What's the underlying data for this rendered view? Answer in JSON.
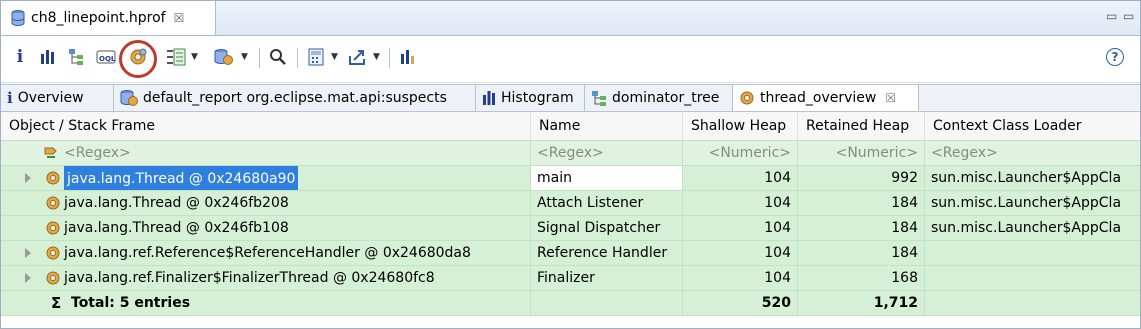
{
  "editor": {
    "tab_title": "ch8_linepoint.hprof",
    "close_glyph": "☒"
  },
  "window_controls": {
    "minimize": "▭",
    "maximize": "▭"
  },
  "toolbar": {
    "icons": [
      "info-icon",
      "histogram-icon",
      "dominator-tree-icon",
      "oql-icon",
      "thread-overview-icon",
      "query-browser-icon",
      "reports-icon",
      "search-icon",
      "calculator-icon",
      "export-icon",
      "heap-dump-overview-icon"
    ],
    "help_label": "?"
  },
  "inner_tabs": [
    {
      "label": "Overview",
      "icon": "info-icon"
    },
    {
      "label": "default_report  org.eclipse.mat.api:suspects",
      "icon": "report-gear-icon"
    },
    {
      "label": "Histogram",
      "icon": "histogram-icon"
    },
    {
      "label": "dominator_tree",
      "icon": "dominator-tree-icon"
    },
    {
      "label": "thread_overview",
      "icon": "thread-gear-icon",
      "active": true,
      "close": "☒"
    }
  ],
  "table": {
    "columns": [
      "Object / Stack Frame",
      "Name",
      "Shallow Heap",
      "Retained Heap",
      "Context Class Loader"
    ],
    "regex_row": {
      "object": "<Regex>",
      "name": "<Regex>",
      "shallow": "<Numeric>",
      "retained": "<Numeric>",
      "loader": "<Regex>"
    },
    "rows": [
      {
        "object": "java.lang.Thread @ 0x24680a90",
        "name": "main",
        "shallow": "104",
        "retained": "992",
        "loader": "sun.misc.Launcher$AppCla",
        "expandable": true,
        "selected": true
      },
      {
        "object": "java.lang.Thread @ 0x246fb208",
        "name": "Attach Listener",
        "shallow": "104",
        "retained": "184",
        "loader": "sun.misc.Launcher$AppCla",
        "expandable": false
      },
      {
        "object": "java.lang.Thread @ 0x246fb108",
        "name": "Signal Dispatcher",
        "shallow": "104",
        "retained": "184",
        "loader": "sun.misc.Launcher$AppCla",
        "expandable": false
      },
      {
        "object": "java.lang.ref.Reference$ReferenceHandler @ 0x24680da8",
        "name": "Reference Handler",
        "shallow": "104",
        "retained": "184",
        "loader": "",
        "expandable": true
      },
      {
        "object": "java.lang.ref.Finalizer$FinalizerThread @ 0x24680fc8",
        "name": "Finalizer",
        "shallow": "104",
        "retained": "168",
        "loader": "",
        "expandable": true
      }
    ],
    "total": {
      "sigma": "Σ",
      "label": "Total: 5 entries",
      "shallow": "520",
      "retained": "1,712"
    }
  },
  "colors": {
    "row_bg": "#d5f0d5",
    "selection": "#2f7fe0",
    "highlight_ring": "#c0392b"
  }
}
